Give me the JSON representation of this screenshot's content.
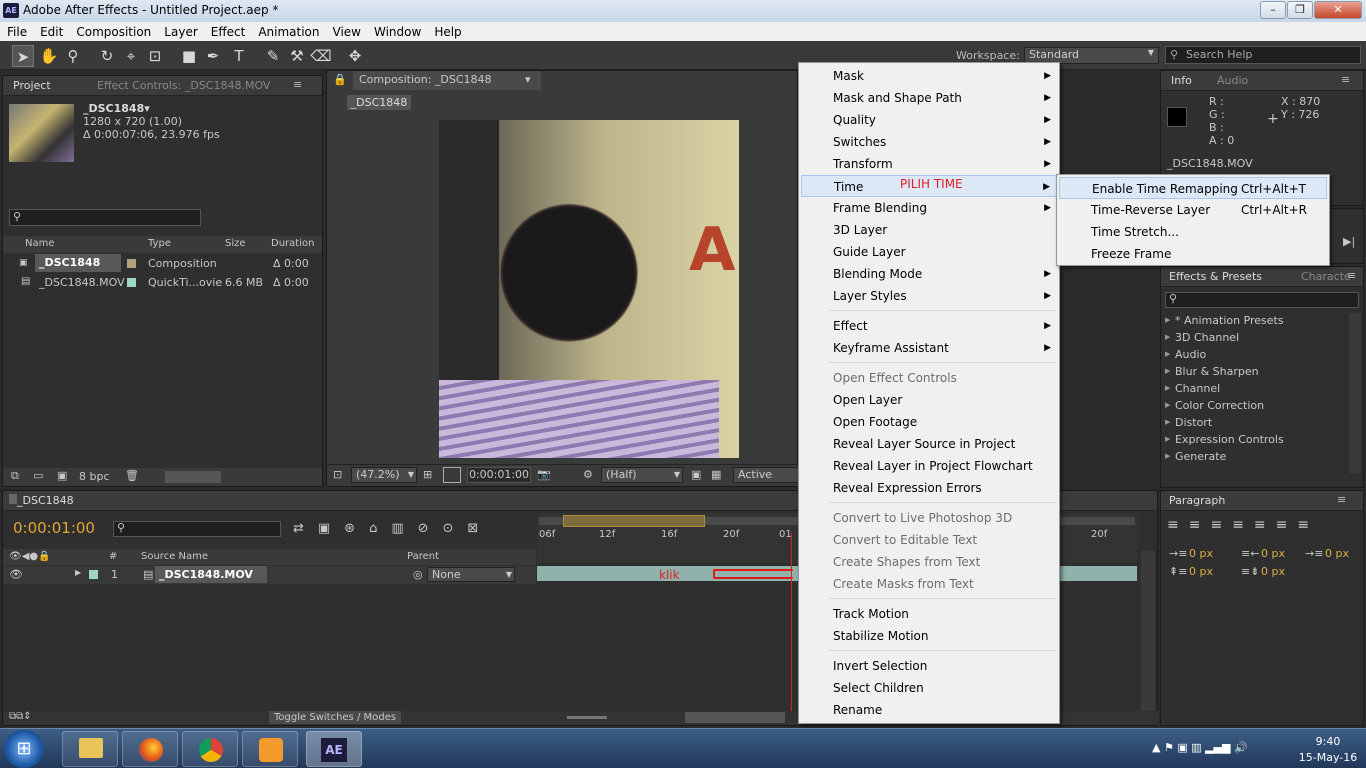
{
  "window": {
    "title": "Adobe After Effects - Untitled Project.aep *",
    "icon": "AE"
  },
  "menubar": [
    "File",
    "Edit",
    "Composition",
    "Layer",
    "Effect",
    "Animation",
    "View",
    "Window",
    "Help"
  ],
  "toolbar": {
    "workspace_label": "Workspace:",
    "workspace_value": "Standard",
    "search_placeholder": "Search Help"
  },
  "project": {
    "tab": "Project",
    "tab2": "Effect Controls: _DSC1848.MOV",
    "item_name": "_DSC1848▾",
    "item_res": "1280 x 720 (1.00)",
    "item_dur": "Δ 0:00:07:06, 23.976 fps",
    "columns": [
      "Name",
      "Type",
      "Size",
      "Duration"
    ],
    "rows": [
      {
        "name": "_DSC1848",
        "type": "Composition",
        "size": "",
        "duration": "Δ 0:00"
      },
      {
        "name": "_DSC1848.MOV",
        "type": "QuickTi...ovie",
        "size": "6.6 MB",
        "duration": "Δ 0:00"
      }
    ],
    "bpc": "8 bpc"
  },
  "composition": {
    "tab": "Composition: _DSC1848",
    "subtab": "_DSC1848",
    "zoom": "(47.2%)",
    "time": "0:00:01:00",
    "res": "(Half)",
    "camera": "Active Came"
  },
  "info": {
    "tab": "Info",
    "tab2": "Audio",
    "r": "R :",
    "g": "G :",
    "b": "B :",
    "a": "A : 0",
    "x": "X : 870",
    "y": "Y : 726",
    "file": "_DSC1848.MOV"
  },
  "effects": {
    "tab": "Effects & Presets",
    "tab2": "Characte",
    "items": [
      "* Animation Presets",
      "3D Channel",
      "Audio",
      "Blur & Sharpen",
      "Channel",
      "Color Correction",
      "Distort",
      "Expression Controls",
      "Generate"
    ]
  },
  "paragraph": {
    "tab": "Paragraph",
    "v1": "0 px",
    "v2": "0 px",
    "v3": "0 px",
    "v4": "0 px",
    "v5": "0 px"
  },
  "timeline": {
    "tab": "_DSC1848",
    "timecode": "0:00:01:00",
    "col_source": "Source Name",
    "col_parent": "Parent",
    "layer_num": "1",
    "layer_name": "_DSC1848.MOV",
    "parent": "None",
    "ruler": [
      "06f",
      "12f",
      "16f",
      "20f",
      "01",
      "20f"
    ],
    "toggle": "Toggle Switches / Modes"
  },
  "annotations": {
    "pilih": "PILIH TIME",
    "klik": "klik"
  },
  "context_menu": [
    {
      "label": "Mask",
      "sub": true
    },
    {
      "label": "Mask and Shape Path",
      "sub": true
    },
    {
      "label": "Quality",
      "sub": true
    },
    {
      "label": "Switches",
      "sub": true
    },
    {
      "label": "Transform",
      "sub": true
    },
    {
      "label": "Time",
      "sub": true,
      "hl": true
    },
    {
      "label": "Frame Blending",
      "sub": true
    },
    {
      "label": "3D Layer"
    },
    {
      "label": "Guide Layer"
    },
    {
      "label": "Blending Mode",
      "sub": true
    },
    {
      "label": "Layer Styles",
      "sub": true
    },
    {
      "sep": true
    },
    {
      "label": "Effect",
      "sub": true
    },
    {
      "label": "Keyframe Assistant",
      "sub": true
    },
    {
      "sep": true
    },
    {
      "label": "Open Effect Controls",
      "dis": true
    },
    {
      "label": "Open Layer"
    },
    {
      "label": "Open Footage"
    },
    {
      "label": "Reveal Layer Source in Project"
    },
    {
      "label": "Reveal Layer in Project Flowchart"
    },
    {
      "label": "Reveal Expression Errors"
    },
    {
      "sep": true
    },
    {
      "label": "Convert to Live Photoshop 3D",
      "dis": true
    },
    {
      "label": "Convert to Editable Text",
      "dis": true
    },
    {
      "label": "Create Shapes from Text",
      "dis": true
    },
    {
      "label": "Create Masks from Text",
      "dis": true
    },
    {
      "sep": true
    },
    {
      "label": "Track Motion"
    },
    {
      "label": "Stabilize Motion"
    },
    {
      "sep": true
    },
    {
      "label": "Invert Selection"
    },
    {
      "label": "Select Children"
    },
    {
      "label": "Rename"
    }
  ],
  "submenu": [
    {
      "label": "Enable Time Remapping",
      "shortcut": "Ctrl+Alt+T",
      "hl": true
    },
    {
      "label": "Time-Reverse Layer",
      "shortcut": "Ctrl+Alt+R"
    },
    {
      "label": "Time Stretch..."
    },
    {
      "label": "Freeze Frame"
    }
  ],
  "taskbar": {
    "time": "9:40",
    "date": "15-May-16"
  }
}
